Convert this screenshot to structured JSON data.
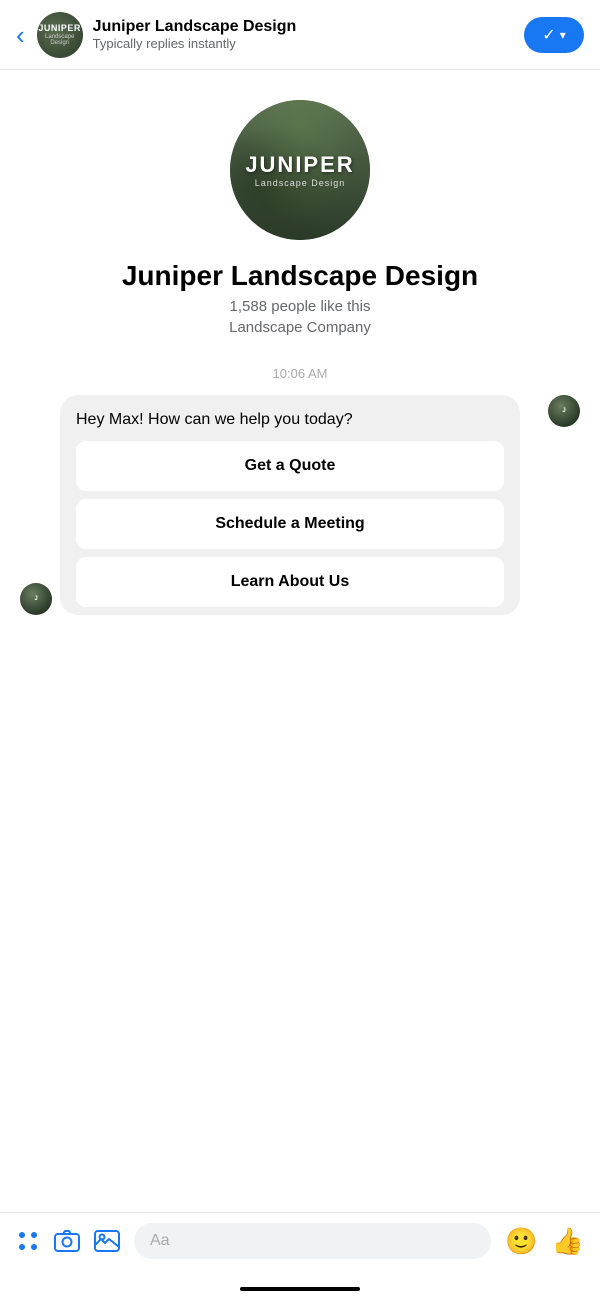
{
  "header": {
    "back_label": "‹",
    "business_name": "Juniper Landscape Design",
    "status": "Typically replies instantly",
    "avatar_brand": "JUNIPER",
    "avatar_tagline": "Landscape Design",
    "action_check": "✓",
    "action_chevron": "▾"
  },
  "profile": {
    "avatar_brand": "JUNIPER",
    "avatar_tagline": "Landscape Design",
    "name": "Juniper Landscape Design",
    "likes": "1,588 people like this",
    "category": "Landscape Company"
  },
  "chat": {
    "timestamp": "10:06 AM",
    "bubble_text": "Hey Max! How can we help you today?",
    "quick_replies": [
      "Get a Quote",
      "Schedule a Meeting",
      "Learn About Us"
    ]
  },
  "toolbar": {
    "input_placeholder": "Aa"
  }
}
